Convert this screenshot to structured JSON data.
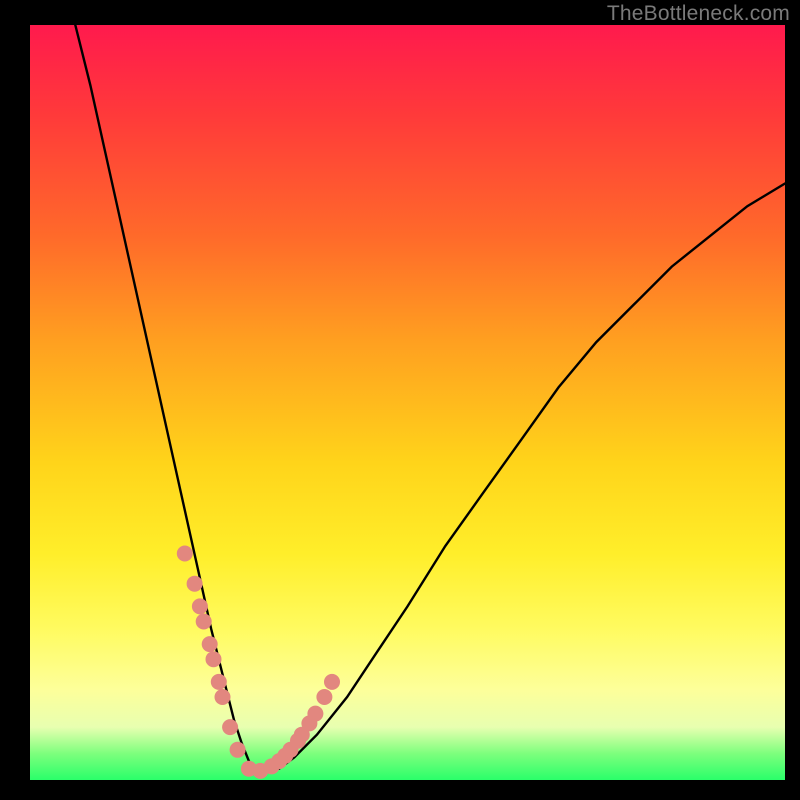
{
  "watermark": "TheBottleneck.com",
  "chart_data": {
    "type": "line",
    "title": "",
    "xlabel": "",
    "ylabel": "",
    "xlim": [
      0,
      100
    ],
    "ylim": [
      0,
      100
    ],
    "series": [
      {
        "name": "bottleneck-curve",
        "x": [
          6,
          8,
          10,
          12,
          14,
          16,
          18,
          20,
          22,
          24,
          26,
          27,
          28,
          29,
          30,
          31,
          33,
          35,
          38,
          42,
          46,
          50,
          55,
          60,
          65,
          70,
          75,
          80,
          85,
          90,
          95,
          100
        ],
        "y": [
          100,
          92,
          83,
          74,
          65,
          56,
          47,
          38,
          29,
          20,
          12,
          8,
          5,
          2.5,
          1.2,
          1.0,
          1.5,
          3,
          6,
          11,
          17,
          23,
          31,
          38,
          45,
          52,
          58,
          63,
          68,
          72,
          76,
          79
        ]
      }
    ],
    "markers": {
      "name": "highlight-dots",
      "color": "#e2877f",
      "points_x": [
        20.5,
        21.8,
        22.5,
        23.0,
        23.8,
        24.3,
        25.0,
        25.5,
        26.5,
        27.5,
        29.0,
        30.5,
        32.0,
        33.0,
        33.8,
        34.5,
        35.5,
        36.0,
        37.0,
        37.8,
        39.0,
        40.0
      ],
      "points_y": [
        30,
        26,
        23,
        21,
        18,
        16,
        13,
        11,
        7,
        4,
        1.5,
        1.2,
        1.8,
        2.5,
        3.2,
        4.0,
        5.2,
        6.0,
        7.5,
        8.8,
        11.0,
        13.0
      ]
    },
    "colors": {
      "curve": "#000000",
      "marker": "#e2877f",
      "gradient_top": "#ff1a4d",
      "gradient_bottom": "#2aff6a"
    }
  }
}
